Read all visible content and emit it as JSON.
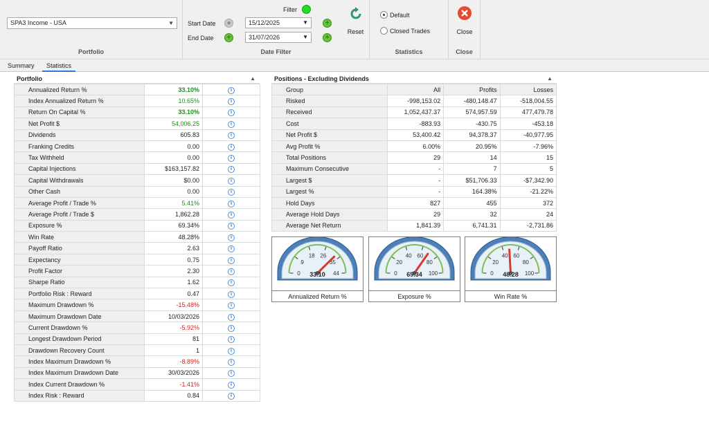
{
  "ribbon": {
    "portfolio": {
      "selected": "SPA3 Income - USA",
      "caption": "Portfolio"
    },
    "date_filter": {
      "filter_label": "Filter",
      "start_label": "Start Date",
      "start_value": "15/12/2025",
      "end_label": "End Date",
      "end_value": "31/07/2026",
      "caption": "Date Filter"
    },
    "reset_label": "Reset",
    "statistics": {
      "default_label": "Default",
      "closed_label": "Closed Trades",
      "caption": "Statistics",
      "selected": "Default"
    },
    "close": {
      "label": "Close",
      "caption": "Close"
    }
  },
  "tabs": [
    {
      "label": "Summary"
    },
    {
      "label": "Statistics",
      "active": true
    }
  ],
  "portfolio_panel": {
    "title": "Portfolio",
    "rows": [
      {
        "label": "Annualized Return %",
        "value": "33.10%",
        "style": "green-bold"
      },
      {
        "label": "Index Annualized Return %",
        "value": "10.65%",
        "style": "green"
      },
      {
        "label": "Return On Capital %",
        "value": "33.10%",
        "style": "green-bold"
      },
      {
        "label": "Net Profit $",
        "value": "54,006.25",
        "style": "green"
      },
      {
        "label": "Dividends",
        "value": "605.83",
        "style": ""
      },
      {
        "label": "Franking Credits",
        "value": "0.00",
        "style": ""
      },
      {
        "label": "Tax Withheld",
        "value": "0.00",
        "style": ""
      },
      {
        "label": "Capital Injections",
        "value": "$163,157.82",
        "style": ""
      },
      {
        "label": "Capital Withdrawals",
        "value": "$0.00",
        "style": ""
      },
      {
        "label": "Other Cash",
        "value": "0.00",
        "style": ""
      },
      {
        "label": "Average Profit / Trade %",
        "value": "5.41%",
        "style": "green"
      },
      {
        "label": "Average Profit / Trade $",
        "value": "1,862.28",
        "style": ""
      },
      {
        "label": "Exposure %",
        "value": "69.34%",
        "style": ""
      },
      {
        "label": "Win Rate",
        "value": "48.28%",
        "style": ""
      },
      {
        "label": "Payoff Ratio",
        "value": "2.63",
        "style": ""
      },
      {
        "label": "Expectancy",
        "value": "0.75",
        "style": ""
      },
      {
        "label": "Profit Factor",
        "value": "2.30",
        "style": ""
      },
      {
        "label": "Sharpe Ratio",
        "value": "1.62",
        "style": ""
      },
      {
        "label": "Portfolio Risk : Reward",
        "value": "0.47",
        "style": ""
      },
      {
        "label": "Maximum Drawdown %",
        "value": "-15.48%",
        "style": "red"
      },
      {
        "label": "Maximum Drawdown Date",
        "value": "10/03/2026",
        "style": ""
      },
      {
        "label": "Current Drawdown %",
        "value": "-5.92%",
        "style": "red"
      },
      {
        "label": "Longest Drawdown Period",
        "value": "81",
        "style": ""
      },
      {
        "label": "Drawdown Recovery Count",
        "value": "1",
        "style": ""
      },
      {
        "label": "Index Maximum Drawdown %",
        "value": "-8.89%",
        "style": "red"
      },
      {
        "label": "Index Maximum Drawdown Date",
        "value": "30/03/2026",
        "style": ""
      },
      {
        "label": "Index Current Drawdown %",
        "value": "-1.41%",
        "style": "red"
      },
      {
        "label": "Index Risk : Reward",
        "value": "0.84",
        "style": ""
      }
    ]
  },
  "positions_panel": {
    "title": "Positions - Excluding Dividends",
    "headers": [
      "Group",
      "All",
      "Profits",
      "Losses"
    ],
    "rows": [
      [
        "Risked",
        "-998,153.02",
        "-480,148.47",
        "-518,004.55"
      ],
      [
        "Received",
        "1,052,437.37",
        "574,957.59",
        "477,479.78"
      ],
      [
        "Cost",
        "-883.93",
        "-430.75",
        "-453.18"
      ],
      [
        "Net Profit $",
        "53,400.42",
        "94,378.37",
        "-40,977.95"
      ],
      [
        "Avg Profit %",
        "6.00%",
        "20.95%",
        "-7.96%"
      ],
      [
        "Total Positions",
        "29",
        "14",
        "15"
      ],
      [
        "Maximum Consecutive",
        "-",
        "7",
        "5"
      ],
      [
        "Largest $",
        "-",
        "$51,706.33",
        "-$7,342.90"
      ],
      [
        "Largest %",
        "-",
        "164.38%",
        "-21.22%"
      ],
      [
        "Hold Days",
        "827",
        "455",
        "372"
      ],
      [
        "Average Hold Days",
        "29",
        "32",
        "24"
      ],
      [
        "Average Net Return",
        "1,841.39",
        "6,741.31",
        "-2,731.86"
      ]
    ]
  },
  "gauges": [
    {
      "caption": "Annualized Return %",
      "value": 33.1,
      "display": "33.10",
      "min": 0,
      "max": 44,
      "ticks": [
        "0",
        "9",
        "18",
        "26",
        "35",
        "44"
      ],
      "needle_color": "#d63a2a"
    },
    {
      "caption": "Exposure %",
      "value": 69.34,
      "display": "69.34",
      "min": 0,
      "max": 100,
      "ticks": [
        "0",
        "20",
        "40",
        "60",
        "80",
        "100"
      ],
      "needle_color": "#d63a2a"
    },
    {
      "caption": "Win Rate %",
      "value": 48.28,
      "display": "48.28",
      "min": 0,
      "max": 100,
      "ticks": [
        "0",
        "20",
        "40",
        "60",
        "80",
        "100"
      ],
      "needle_color": "#d63a2a"
    }
  ]
}
